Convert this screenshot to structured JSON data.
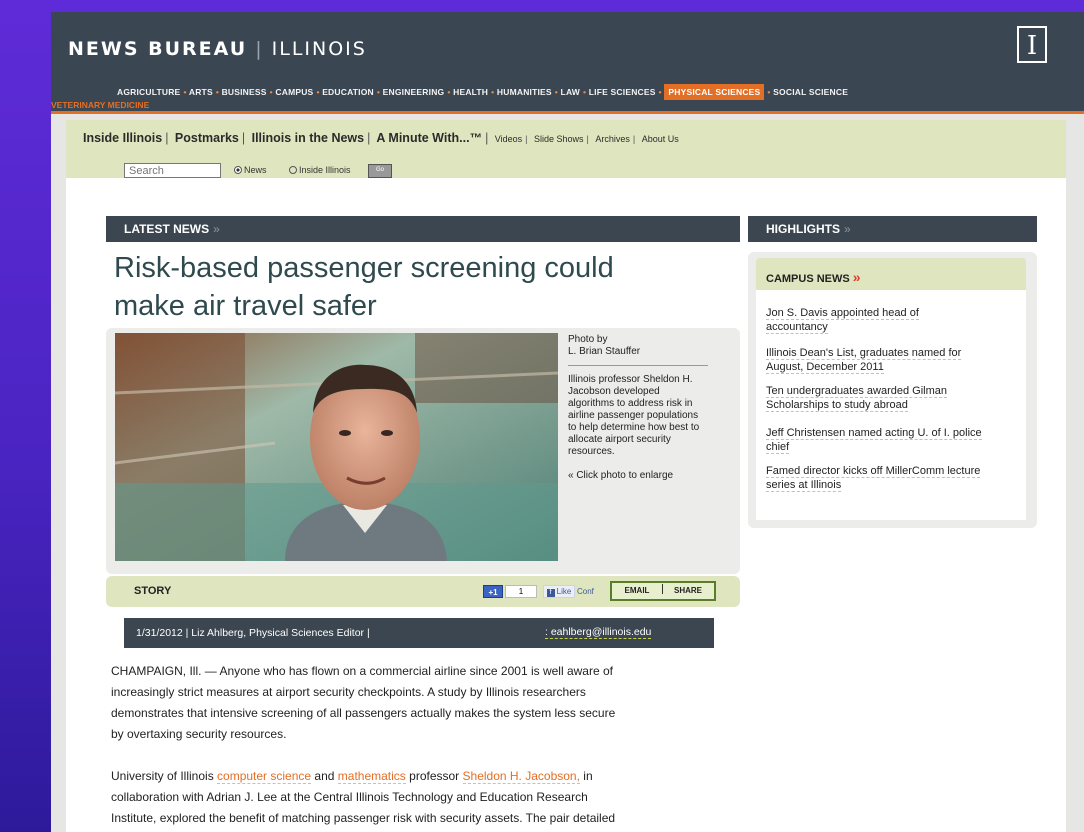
{
  "masthead": {
    "brand_bold": "NEWS BUREAU",
    "brand_sep": "|",
    "brand_sub": "ILLINOIS",
    "logo_glyph": "I",
    "nav_items": [
      "AGRICULTURE",
      "ARTS",
      "BUSINESS",
      "CAMPUS",
      "EDUCATION",
      "ENGINEERING",
      "HEALTH",
      "HUMANITIES",
      "LAW",
      "LIFE SCIENCES",
      "PHYSICAL SCIENCES",
      "SOCIAL SCIENCE"
    ],
    "nav_active": "PHYSICAL SCIENCES",
    "nav_row2": "VETERINARY MEDICINE"
  },
  "subnav": {
    "links": [
      "Inside Illinois",
      "Postmarks",
      "Illinois in the News",
      "A Minute With...™"
    ],
    "small_links": [
      "Videos",
      "Slide Shows",
      "Archives",
      "About Us"
    ],
    "search_placeholder": "Search",
    "radio_news": "News",
    "radio_inside": "Inside Illinois",
    "go_label": "Go"
  },
  "latest": {
    "header": "LATEST NEWS",
    "chevron": "»",
    "headline_line1": "Risk-based passenger screening could",
    "headline_line2": "make air travel safer"
  },
  "photo": {
    "credit_line1": "Photo by",
    "credit_line2": "L. Brian Stauffer",
    "caption": "Illinois professor Sheldon H. Jacobson developed algorithms to address risk in airline passenger populations to help determine how best to allocate airport security resources.",
    "enlarge": "« Click photo to enlarge"
  },
  "story": {
    "label": "STORY",
    "plus_one": "+1",
    "plus_count": "1",
    "like": "Like",
    "conf": "Conf",
    "email": "EMAIL",
    "share": "SHARE",
    "byline_left": "1/31/2012 | Liz Ahlberg, Physical Sciences Editor |",
    "byline_right": ": eahlberg@illinois.edu",
    "p1": [
      "CHAMPAIGN, Ill. — Anyone who has flown on a commercial airline since 2001 is well aware of",
      "increasingly strict measures at airport security checkpoints. A study by Illinois researchers",
      "demonstrates that intensive screening of all passengers actually makes the system less secure",
      "by overtaxing security resources."
    ],
    "p2_a": "University of Illinois ",
    "p2_link1": "computer science",
    "p2_b": " and ",
    "p2_link2": "mathematics",
    "p2_c": " professor ",
    "p2_link3": "Sheldon H. Jacobson,",
    "p2_d": " in",
    "p2_rest": [
      "collaboration with Adrian J. Lee at the Central Illinois Technology and Education Research",
      "Institute, explored the benefit of matching passenger risk with security assets. The pair detailed"
    ]
  },
  "highlights": {
    "header": "HIGHLIGHTS",
    "chevron": "»",
    "campus_news": "CAMPUS NEWS",
    "campus_chev": "»",
    "items": [
      {
        "line1": "Jon S. Davis appointed head of",
        "line2": "accountancy"
      },
      {
        "line1": "Illinois Dean's List, graduates named for",
        "line2": "August, December 2011"
      },
      {
        "line1": "Ten undergraduates awarded Gilman",
        "line2": "Scholarships to study abroad"
      },
      {
        "line1": "Jeff Christensen named acting U. of I. police",
        "line2": "chief"
      },
      {
        "line1": "Famed director kicks off MillerComm lecture",
        "line2": "series at Illinois"
      }
    ]
  }
}
